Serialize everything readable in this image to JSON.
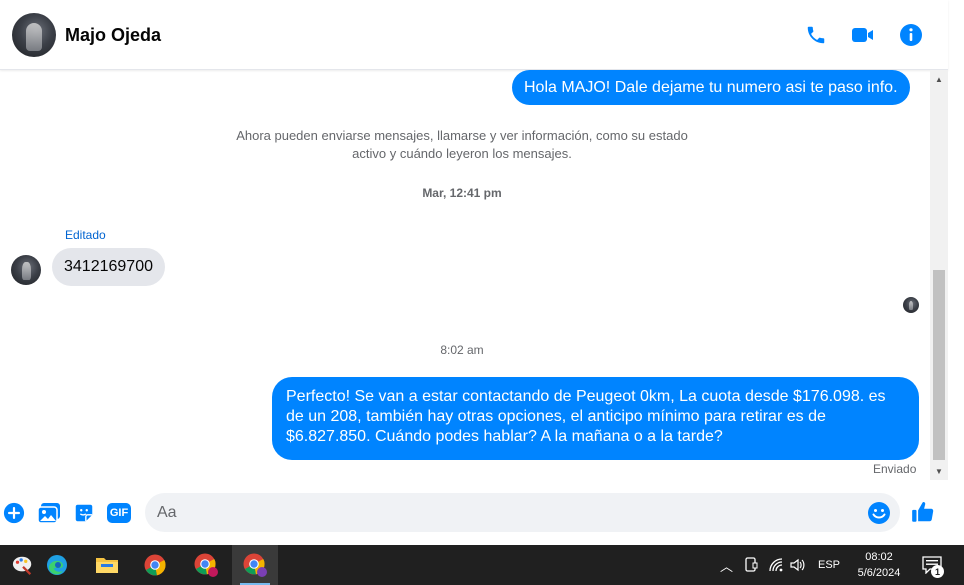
{
  "header": {
    "contact_name": "Majo Ojeda",
    "icons": [
      "phone-icon",
      "video-camera-icon",
      "info-icon"
    ]
  },
  "messages": {
    "outgoing_1": "Hola MAJO! Dale dejame tu numero asi te paso info.",
    "system_notice_line1": "Ahora pueden enviarse mensajes, llamarse y ver información, como su estado",
    "system_notice_line2": "activo y cuándo leyeron los mensajes.",
    "timestamp_1": "Mar, 12:41 pm",
    "edited_label": "Editado",
    "incoming_1": "3412169700",
    "timestamp_2": "8:02 am",
    "outgoing_2_line1": "Perfecto!  Se van a estar contactando de Peugeot 0km, La cuota desde $176.098. es",
    "outgoing_2_line2": "de un 208, también hay otras opciones, el anticipo mínimo para retirar es de",
    "outgoing_2_line3": "$6.827.850. Cuándo podes hablar? A la mañana o a la tarde?",
    "status": "Enviado"
  },
  "composer": {
    "placeholder": "Aa",
    "icons": [
      "plus-circle-icon",
      "photo-icon",
      "sticker-icon",
      "gif-icon",
      "emoji-icon",
      "thumbs-up-icon"
    ],
    "gif_label": "GIF"
  },
  "taskbar": {
    "apps": [
      "paint-app-icon",
      "edge-icon",
      "file-explorer-icon",
      "chrome-icon",
      "chrome-profile-icon",
      "chrome-active-icon"
    ],
    "tray": {
      "language": "ESP",
      "time": "08:02",
      "date": "5/6/2024",
      "notification_count": "1"
    }
  },
  "colors": {
    "accent": "#0084ff",
    "incoming_bubble": "#e4e6eb",
    "taskbar": "#202020"
  }
}
